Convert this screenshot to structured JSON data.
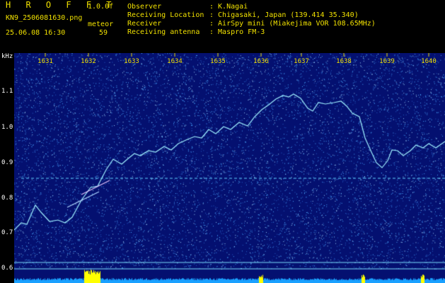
{
  "header": {
    "logo_letters": "H R O F F T",
    "version": "1.0.0f",
    "filename": "KN9_2506081630.png",
    "meteor_label": "meteor",
    "date_time": "25.06.08 16:30",
    "count": "59",
    "info": [
      {
        "label": "Observer",
        "value": ": K.Nagai"
      },
      {
        "label": "Receiving Location",
        "value": ": Chigasaki, Japan (139.414 35.340)"
      },
      {
        "label": "Receiver",
        "value": ": AirSpy mini (Miakejima VOR 108.65MHz)"
      },
      {
        "label": "Receiving antenna",
        "value": ": Maspro FM-3"
      }
    ]
  },
  "axis": {
    "y_unit": "kHz",
    "x_ticks": [
      "1631",
      "1632",
      "1633",
      "1634",
      "1635",
      "1636",
      "1637",
      "1638",
      "1639",
      "1640"
    ],
    "y_ticks": [
      "1.1",
      "1.0",
      "0.9",
      "0.8",
      "0.7",
      "0.6"
    ]
  },
  "colors": {
    "background": "#041070",
    "noise": "#4aa8ff",
    "trace": "#9ff0ff",
    "ticks": "#f0e000",
    "histogram_base": "#1aa0ff",
    "histogram_peak": "#ffff00"
  }
}
